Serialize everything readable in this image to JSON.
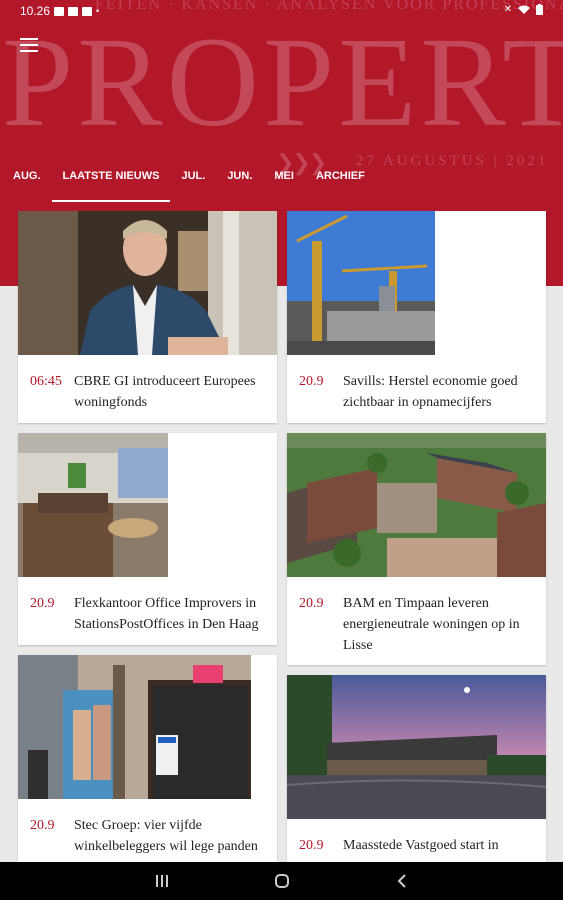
{
  "status": {
    "time": "10.26"
  },
  "header": {
    "tagline": "FEITEN · KANSEN · ANALYSEN VOOR PROFESSIONALS",
    "brand": "PROPERTY",
    "date_line": "27 AUGUSTUS  |  2021"
  },
  "tabs": [
    {
      "label": "AUG.",
      "active": false
    },
    {
      "label": "LAATSTE NIEUWS",
      "active": true
    },
    {
      "label": "JUL.",
      "active": false
    },
    {
      "label": "JUN.",
      "active": false
    },
    {
      "label": "MEI",
      "active": false
    },
    {
      "label": "ARCHIEF",
      "active": false
    }
  ],
  "articles": [
    {
      "time": "06:45",
      "title": "CBRE GI introduceert Europees woningfonds"
    },
    {
      "time": "20.9",
      "title": "Savills: Herstel economie goed zichtbaar in opnamecijfers"
    },
    {
      "time": "20.9",
      "title": "Flexkantoor Office Improvers in StationsPostOffices in Den Haag"
    },
    {
      "time": "20.9",
      "title": "BAM en Timpaan leveren energieneutrale woningen op in Lisse"
    },
    {
      "time": "20.9",
      "title": "Stec Groep: vier vijfde winkelbeleggers wil lege panden"
    },
    {
      "time": "20.9",
      "title": "Maasstede Vastgoed start in"
    }
  ]
}
